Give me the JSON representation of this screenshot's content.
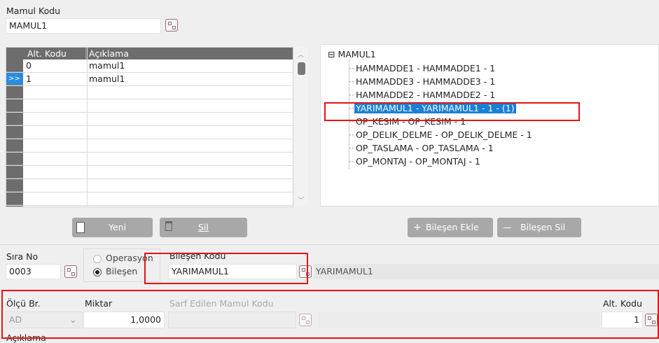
{
  "mamul": {
    "label": "Mamul Kodu",
    "value": "MAMUL1"
  },
  "grid": {
    "columns": [
      "Alt. Kodu",
      "Açıklama"
    ],
    "rows": [
      {
        "indicator": "",
        "alt_kodu": "0",
        "aciklama": "mamul1"
      },
      {
        "indicator": ">>",
        "alt_kodu": "1",
        "aciklama": "mamul1"
      }
    ],
    "new_button": "Yeni",
    "delete_button": "Sil"
  },
  "tree": {
    "root": "MAMUL1",
    "collapse_symbol": "⊟",
    "children": [
      "HAMMADDE1 - HAMMADDE1 - 1",
      "HAMMADDE3 - HAMMADDE3 - 1",
      "HAMMADDE2 - HAMMADDE2 - 1",
      "YARIMAMUL1 - YARIMAMUL1 - 1 - (1)",
      "OP_KESIM - OP_KESIM - 1",
      "OP_DELIK_DELME - OP_DELIK_DELME - 1",
      "OP_TASLAMA - OP_TASLAMA - 1",
      "OP_MONTAJ - OP_MONTAJ - 1"
    ],
    "selected_index": 3,
    "add_button": "Bileşen Ekle",
    "remove_button": "Bileşen Sil",
    "add_symbol": "+",
    "remove_symbol": "—"
  },
  "form": {
    "sira_no_label": "Sıra No",
    "sira_no_value": "0003",
    "radio_operasyon": "Operasyon",
    "radio_bilesen": "Bileşen",
    "radio_selected": "Bileşen",
    "bilesen_kodu_label": "Bileşen Kodu",
    "bilesen_kodu_value": "YARIMAMUL1",
    "bilesen_desc": "YARIMAMUL1",
    "olcu_label": "Ölçü Br.",
    "olcu_value": "AD",
    "miktar_label": "Miktar",
    "miktar_value": "1,0000",
    "sarf_label": "Sarf Edilen Mamul Kodu",
    "sarf_value": "",
    "alt_kodu_label": "Alt. Kodu",
    "alt_kodu_value": "1",
    "aciklama_label": "Açıklama"
  },
  "colors": {
    "accent_red": "#e21414",
    "selection": "#1a7fd6",
    "header_gray": "#6d6d6d"
  }
}
